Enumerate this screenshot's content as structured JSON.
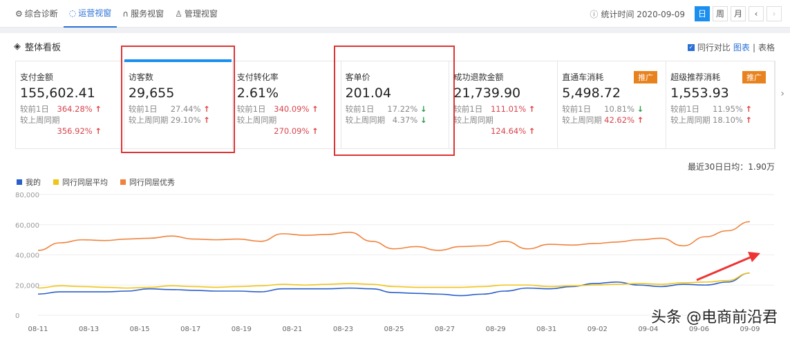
{
  "nav": [
    {
      "label": "综合诊断",
      "icon": "diagnosis-icon"
    },
    {
      "label": "运营视窗",
      "icon": "shield-icon",
      "active": true
    },
    {
      "label": "服务视窗",
      "icon": "headset-icon"
    },
    {
      "label": "管理视窗",
      "icon": "person-icon"
    }
  ],
  "header": {
    "stat_time": "统计时间 2020-09-09",
    "periods": [
      "日",
      "周",
      "月"
    ],
    "prev": "‹",
    "next": "›"
  },
  "section": {
    "title": "整体看板",
    "compare": "同行对比",
    "chart": "图表",
    "sep": "|",
    "table": "表格"
  },
  "cards": [
    {
      "title": "支付金额",
      "value": "155,602.41",
      "d1_label": "较前1日",
      "d1": "364.28%",
      "d1_dir": "up",
      "w_label": "较上周同期",
      "w": "356.92%",
      "w_dir": "up",
      "red": true,
      "wrap": true
    },
    {
      "title": "访客数",
      "value": "29,655",
      "d1_label": "较前1日",
      "d1": "27.44%",
      "d1_dir": "up",
      "w_label": "较上周同期",
      "w": "29.10%",
      "w_dir": "up"
    },
    {
      "title": "支付转化率",
      "value": "2.61%",
      "d1_label": "较前1日",
      "d1": "340.09%",
      "d1_dir": "up",
      "w_label": "较上周同期",
      "w": "270.09%",
      "w_dir": "up",
      "red": true,
      "wrap": true
    },
    {
      "title": "客单价",
      "value": "201.04",
      "d1_label": "较前1日",
      "d1": "17.22%",
      "d1_dir": "down",
      "w_label": "较上周同期",
      "w": "4.37%",
      "w_dir": "down"
    },
    {
      "title": "成功退款金额",
      "value": "21,739.90",
      "d1_label": "较前1日",
      "d1": "111.01%",
      "d1_dir": "up",
      "w_label": "较上周同期",
      "w": "124.64%",
      "w_dir": "up",
      "red": true,
      "wrap": true
    },
    {
      "title": "直通车消耗",
      "value": "5,498.72",
      "d1_label": "较前1日",
      "d1": "10.81%",
      "d1_dir": "down",
      "w_label": "较上周同期",
      "w": "42.62%",
      "w_dir": "up",
      "wred": true,
      "tag": "推广"
    },
    {
      "title": "超级推荐消耗",
      "value": "1,553.93",
      "d1_label": "较前1日",
      "d1": "11.95%",
      "d1_dir": "up",
      "w_label": "较上周同期",
      "w": "18.10%",
      "w_dir": "up",
      "tag": "推广"
    }
  ],
  "avg": "最近30日日均：1.90万",
  "watermark": "头条 @电商前沿君",
  "chart_data": {
    "type": "line",
    "ylim": [
      0,
      80000
    ],
    "yticks": [
      "0",
      "20,000",
      "40,000",
      "60,000",
      "80,000"
    ],
    "xticks": [
      "08-11",
      "08-13",
      "08-15",
      "08-17",
      "08-19",
      "08-21",
      "08-23",
      "08-25",
      "08-27",
      "08-29",
      "08-31",
      "09-02",
      "09-04",
      "09-06",
      "09-09"
    ],
    "series": [
      {
        "name": "我的",
        "color": "#2a5fc9",
        "values": [
          14000,
          15500,
          15500,
          15500,
          16000,
          17500,
          17000,
          16500,
          16000,
          16000,
          15500,
          17500,
          17500,
          17500,
          18000,
          17500,
          15000,
          14500,
          14000,
          13000,
          14000,
          16000,
          18000,
          17500,
          19000,
          21000,
          22000,
          20000,
          19000,
          20500,
          20000,
          22000,
          28000
        ]
      },
      {
        "name": "同行同层平均",
        "color": "#f0c419",
        "values": [
          18000,
          19500,
          19000,
          18500,
          18000,
          18500,
          19500,
          19000,
          18500,
          19000,
          19500,
          20500,
          20000,
          20500,
          21000,
          20500,
          19000,
          18500,
          18500,
          18500,
          19000,
          20000,
          20000,
          19000,
          19500,
          20000,
          20500,
          21000,
          20500,
          21500,
          22000,
          23000,
          28000
        ]
      },
      {
        "name": "同行同层优秀",
        "color": "#f0823c",
        "values": [
          43000,
          48000,
          50000,
          49500,
          50500,
          51000,
          52500,
          50500,
          50000,
          50500,
          49000,
          54000,
          53000,
          53500,
          55000,
          49000,
          44000,
          45500,
          43000,
          45500,
          46000,
          49000,
          44000,
          47000,
          46500,
          47500,
          48500,
          50000,
          51000,
          46000,
          52000,
          56000,
          62000
        ]
      }
    ]
  }
}
